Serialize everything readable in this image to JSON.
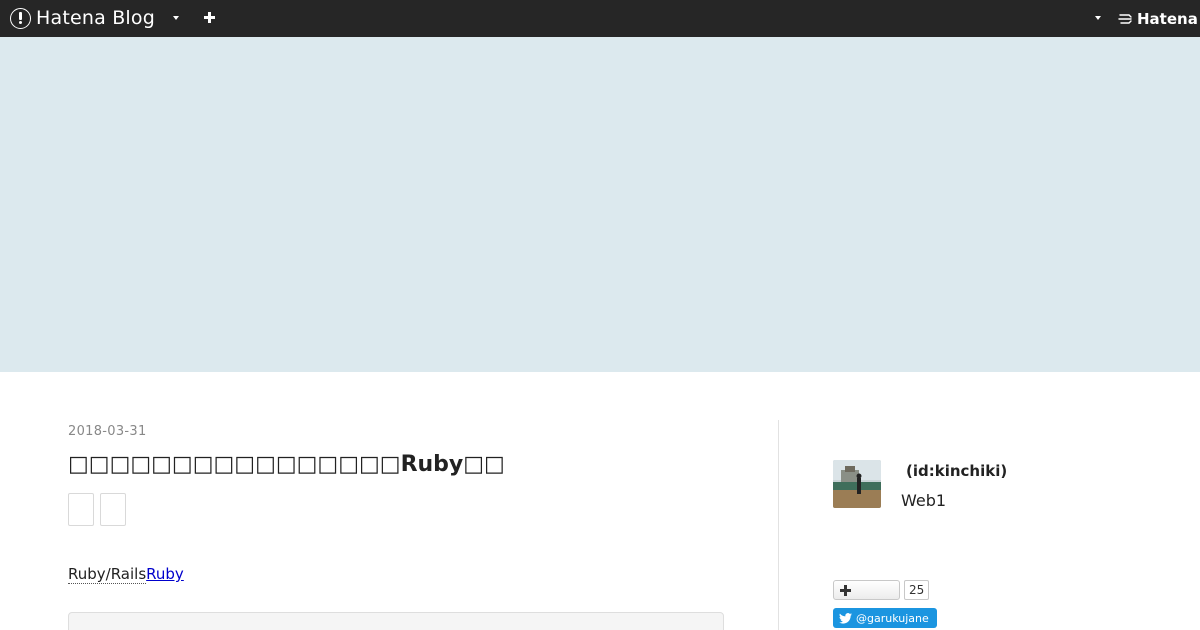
{
  "global_header": {
    "brand": "Hatena Blog",
    "hatena_logo": "Hatena",
    "icons": {
      "brand": "hatena-blog-logo-icon",
      "menu": "chevron-down-icon",
      "new_post": "plus-icon",
      "user_menu": "chevron-down-icon",
      "hatena": "hatena-logo-icon"
    },
    "background_color": "#262626"
  },
  "banner": {
    "color": "#dce9ee"
  },
  "entry": {
    "date": "2018-03-31",
    "title": "□□□□□□□□□□□□□□□□Ruby□□",
    "lead_text": "Ruby/Rails",
    "lead_link": "Ruby"
  },
  "sidebar": {
    "profile": {
      "id": "(id:kinchiki)",
      "description": "Web1"
    },
    "subscribe": {
      "icon": "plus-icon",
      "count": "25"
    },
    "twitter": {
      "icon": "twitter-bird-icon",
      "handle": "@garukujane",
      "color": "#1b95e0"
    }
  }
}
